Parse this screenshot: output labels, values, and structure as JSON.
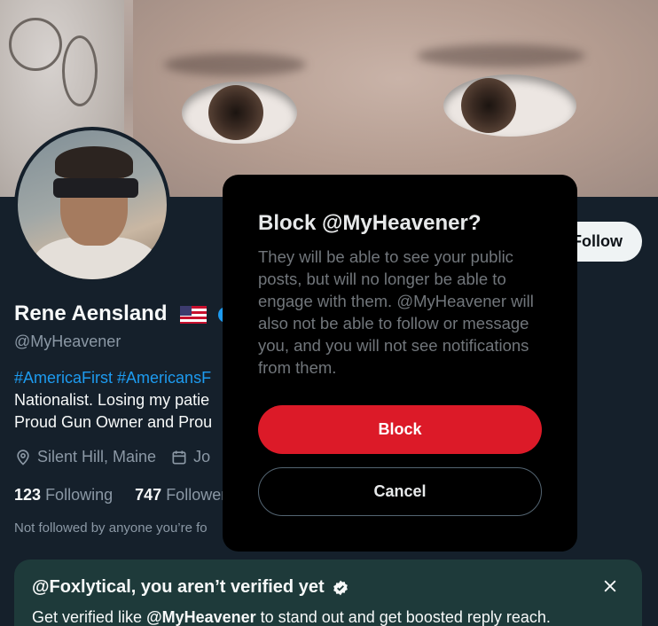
{
  "profile": {
    "name": "Rene Aensland",
    "handle": "@MyHeavener",
    "bio_line1_tag1": "#AmericaFirst",
    "bio_line1_tag2": "#AmericansF",
    "bio_line2": "Nationalist. Losing my patie",
    "bio_line3": "Proud Gun Owner and Prou",
    "location": "Silent Hill, Maine",
    "joined_partial": "Jo",
    "following_count": "123",
    "following_label": "Following",
    "followers_count": "747",
    "followers_label": "Follower",
    "not_followed_text": "Not followed by anyone you’re fo",
    "follow_button_label": "Follow"
  },
  "verify_card": {
    "title": "@Foxlytical, you aren’t verified yet",
    "body_prefix": "Get verified like ",
    "body_handle": "@MyHeavener",
    "body_suffix": " to stand out and get boosted reply reach."
  },
  "dialog": {
    "title": "Block @MyHeavener?",
    "body": "They will be able to see your public posts, but will no longer be able to engage with them. @MyHeavener will also not be able to follow or message you, and you will not see notifications from them.",
    "block_label": "Block",
    "cancel_label": "Cancel"
  },
  "colors": {
    "block_red": "#dc1a28",
    "link_blue": "#1d9bf0",
    "background": "#15202b",
    "dialog_bg": "#000000"
  },
  "icons": [
    "location-icon",
    "calendar-icon",
    "verified-check-icon",
    "close-icon"
  ]
}
